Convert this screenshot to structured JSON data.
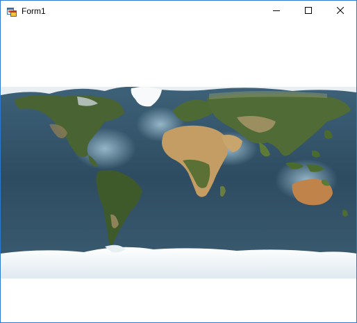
{
  "window": {
    "title": "Form1",
    "app_icon": "winforms-app-icon",
    "controls": {
      "minimize_icon": "minimize-icon",
      "maximize_icon": "maximize-icon",
      "close_icon": "close-icon"
    },
    "border_color": "#2b79d0"
  },
  "main": {
    "image_name": "world-map-satellite-image",
    "colors": {
      "ocean": "#2f4f64",
      "ocean_shallow": "#7fa3b8",
      "land_green": "#3f5a2a",
      "land_desert": "#c6a06a",
      "ice": "#f4f7fa"
    }
  }
}
